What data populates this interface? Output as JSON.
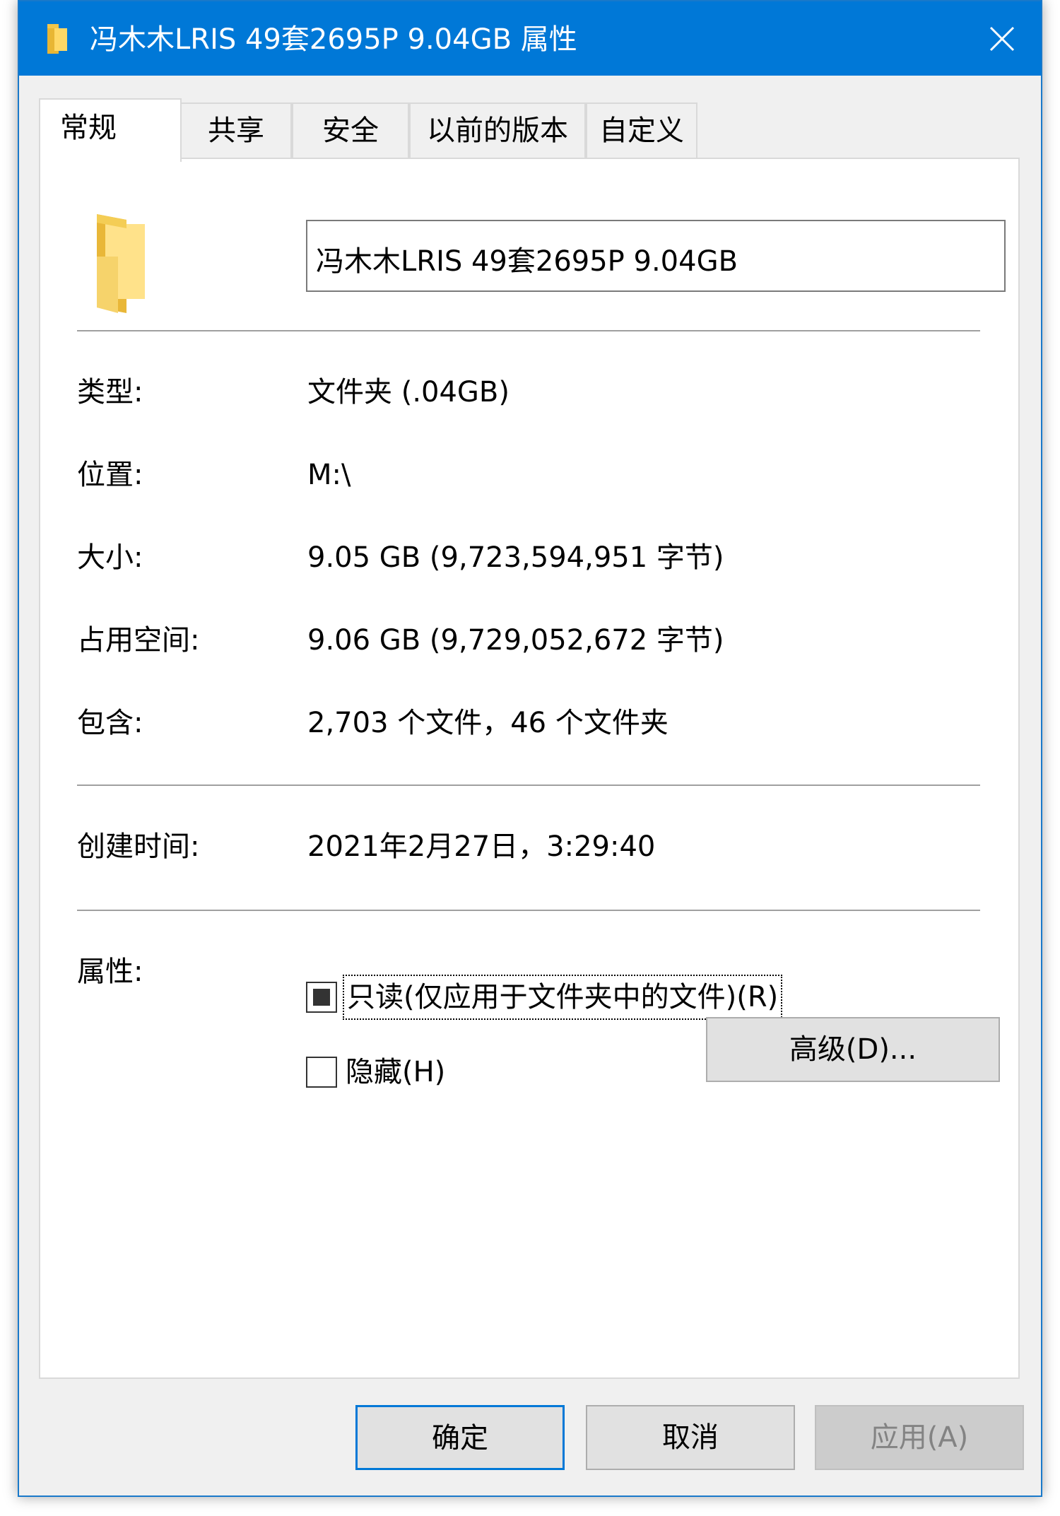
{
  "window": {
    "title": "冯木木LRIS 49套2695P 9.04GB 属性",
    "accent": "#0078d7"
  },
  "tabs": [
    {
      "label": "常规"
    },
    {
      "label": "共享"
    },
    {
      "label": "安全"
    },
    {
      "label": "以前的版本"
    },
    {
      "label": "自定义"
    }
  ],
  "general": {
    "name_value": "冯木木LRIS 49套2695P 9.04GB",
    "type_label": "类型:",
    "type_value": "文件夹 (.04GB)",
    "location_label": "位置:",
    "location_value": "M:\\",
    "size_label": "大小:",
    "size_value": "9.05 GB (9,723,594,951 字节)",
    "size_on_disk_label": "占用空间:",
    "size_on_disk_value": "9.06 GB (9,729,052,672 字节)",
    "contains_label": "包含:",
    "contains_value": "2,703 个文件，46 个文件夹",
    "created_label": "创建时间:",
    "created_value": "2021年2月27日，3:29:40",
    "attributes_label": "属性:",
    "readonly_label": "只读(仅应用于文件夹中的文件)(R)",
    "hidden_label": "隐藏(H)",
    "advanced_button": "高级(D)..."
  },
  "buttons": {
    "ok": "确定",
    "cancel": "取消",
    "apply": "应用(A)"
  },
  "icons": {
    "title_icon": "folder-icon",
    "close": "close-icon",
    "big_folder": "folder-icon"
  }
}
